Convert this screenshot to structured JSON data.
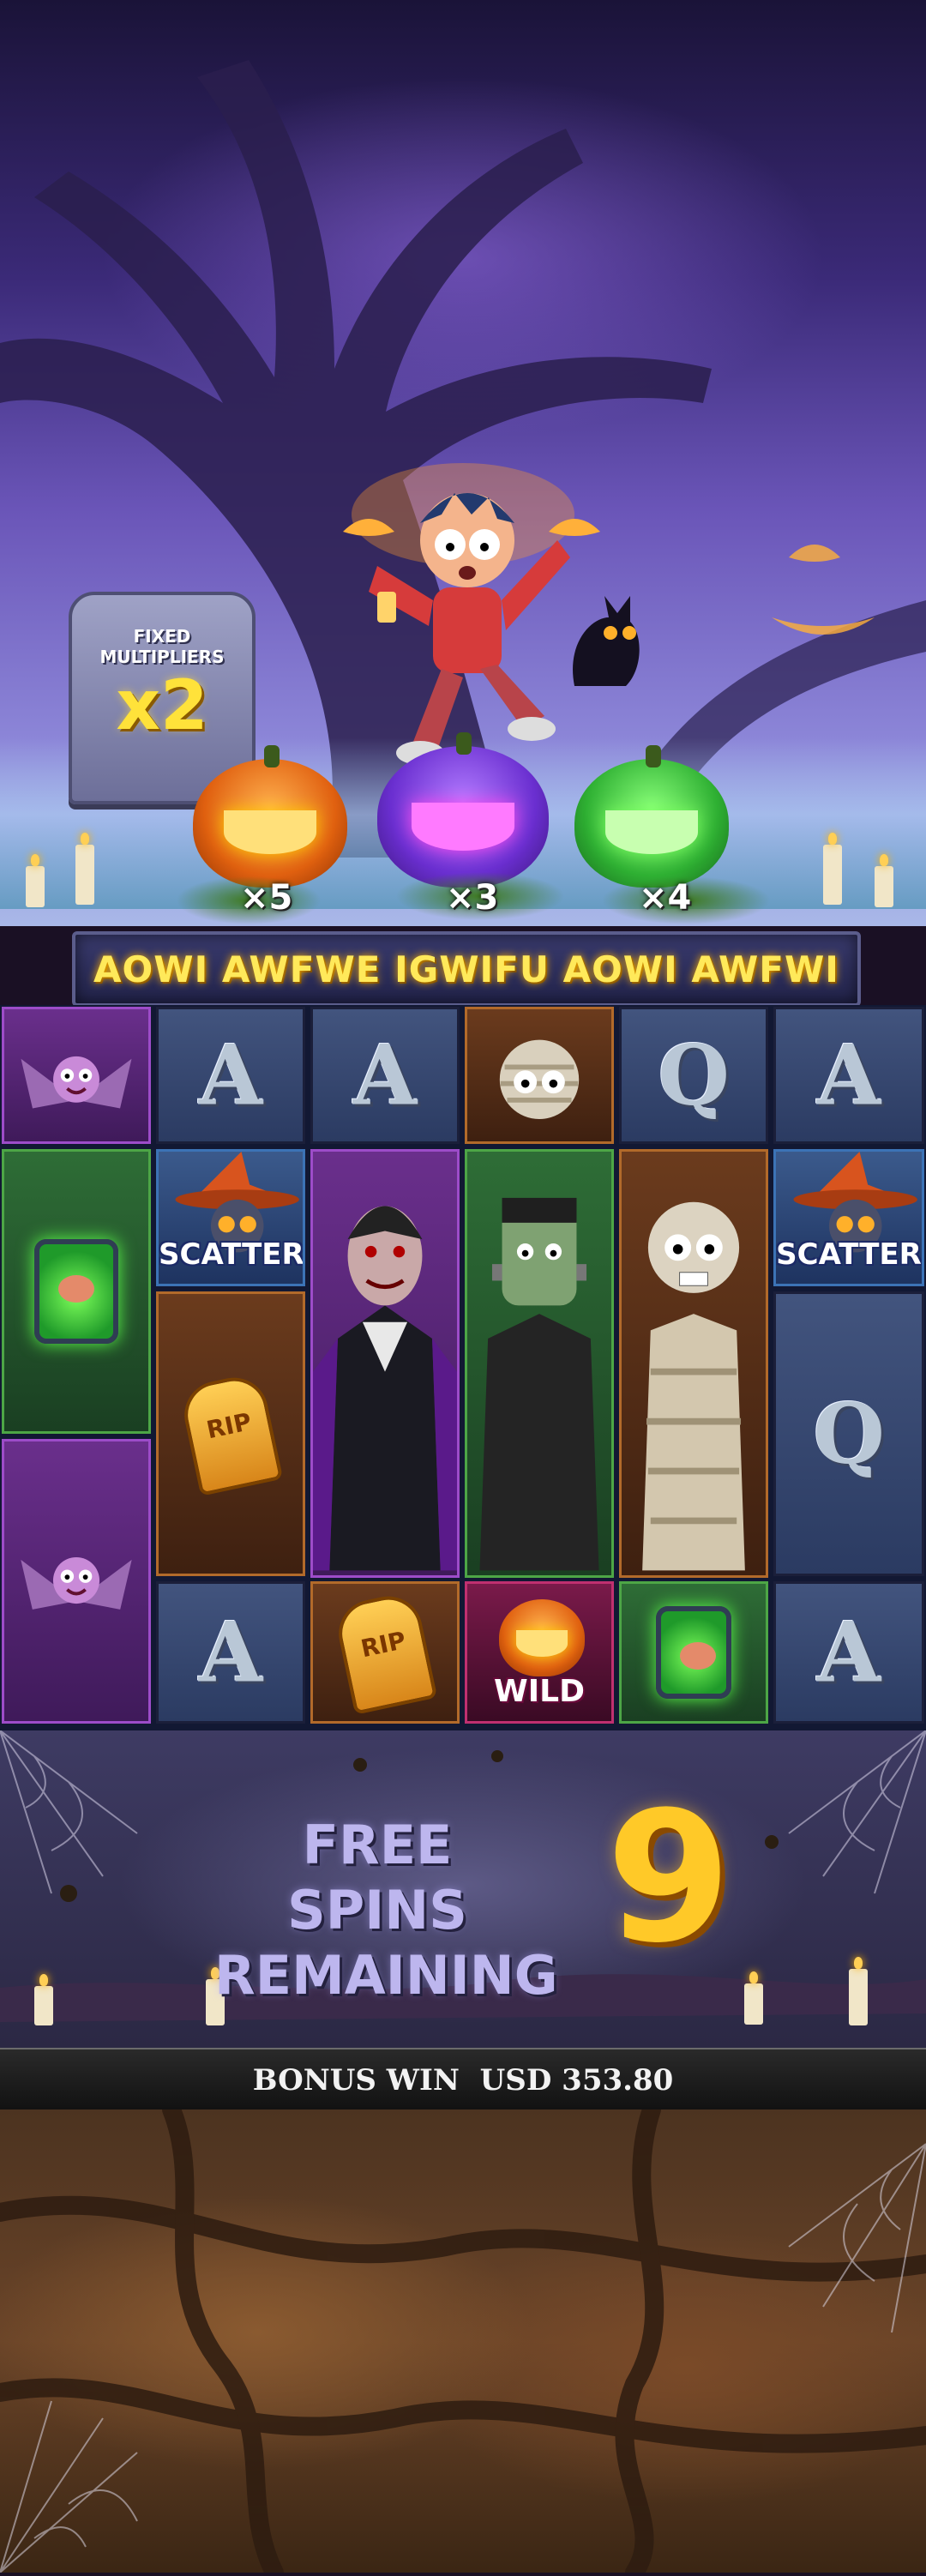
{
  "multiplier_stone": {
    "title_line1": "FIXED",
    "title_line2": "MULTIPLIERS",
    "value": "x2"
  },
  "pumpkins": [
    {
      "color": "#e06010",
      "multiplier": "×5"
    },
    {
      "color": "#6a2fd0",
      "multiplier": "×3"
    },
    {
      "color": "#2fb033",
      "multiplier": "×4"
    }
  ],
  "banner": {
    "text": "AOWI AWFWE IGWIFU AOWI AWFWI"
  },
  "reels": {
    "symbols": {
      "A": "A",
      "Q": "Q",
      "scatter_label": "SCATTER",
      "wild_label": "WILD",
      "rip_label": "RIP"
    }
  },
  "free_spins": {
    "label_line1": "FREE SPINS",
    "label_line2": "REMAINING",
    "count": "9"
  },
  "bonus": {
    "label": "BONUS WIN  USD 353.80"
  }
}
